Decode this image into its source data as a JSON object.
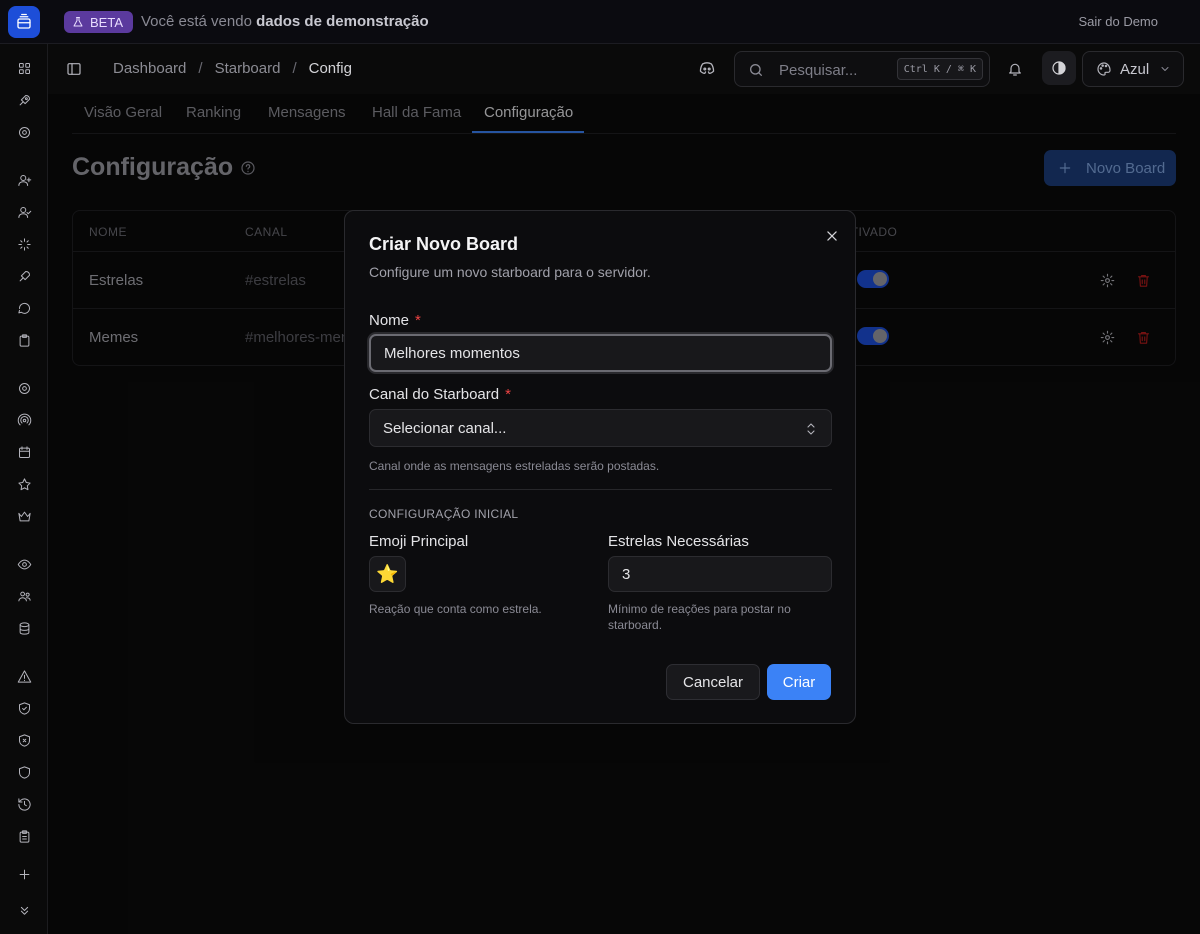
{
  "banner": {
    "beta_label": "BETA",
    "text_prefix": "Você está vendo",
    "text_bold": "dados de demonstração",
    "exit_label": "Sair do Demo"
  },
  "header": {
    "breadcrumb": [
      "Dashboard",
      "Starboard",
      "Config"
    ],
    "breadcrumb_separator": "/",
    "search_placeholder": "Pesquisar...",
    "search_shortcut": "Ctrl K / ⌘ K",
    "color_label": "Azul"
  },
  "tabs": [
    {
      "label": "Visão Geral",
      "active": false
    },
    {
      "label": "Ranking",
      "active": false
    },
    {
      "label": "Mensagens",
      "active": false
    },
    {
      "label": "Hall da Fama",
      "active": false
    },
    {
      "label": "Configuração",
      "active": true
    }
  ],
  "page": {
    "title": "Configuração",
    "new_board_label": "Novo Board"
  },
  "table": {
    "columns": [
      "NOME",
      "CANAL",
      "ATIVADO"
    ],
    "rows": [
      {
        "name": "Estrelas",
        "channel": "#estrelas",
        "enabled": true
      },
      {
        "name": "Memes",
        "channel": "#melhores-mem",
        "enabled": true
      }
    ]
  },
  "modal": {
    "title": "Criar Novo Board",
    "description": "Configure um novo starboard para o servidor.",
    "name_label": "Nome",
    "name_value": "Melhores momentos",
    "channel_label": "Canal do Starboard",
    "channel_value": "Selecionar canal...",
    "channel_hint": "Canal onde as mensagens estreladas serão postadas.",
    "required_mark": "*",
    "section_label": "CONFIGURAÇÃO INICIAL",
    "emoji_label": "Emoji Principal",
    "emoji_value": "⭐",
    "emoji_hint": "Reação que conta como estrela.",
    "stars_label": "Estrelas Necessárias",
    "stars_value": "3",
    "stars_hint": "Mínimo de reações para postar no starboard.",
    "cancel_label": "Cancelar",
    "create_label": "Criar"
  },
  "colors": {
    "accent": "#3b82f6",
    "danger": "#ef4444",
    "beta": "#5b3a9e",
    "toggle_on": "#1d4ed8"
  }
}
